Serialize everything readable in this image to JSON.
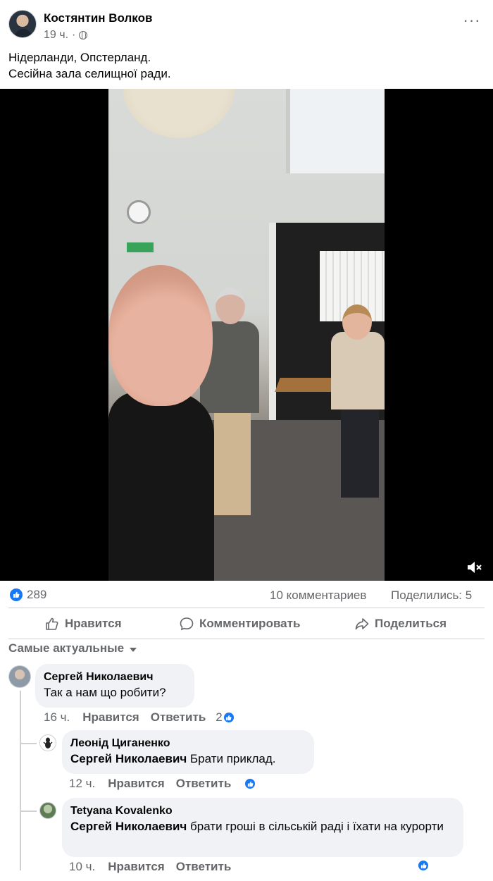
{
  "post": {
    "author": "Костянтин Волков",
    "time": "19 ч.",
    "separator": "·",
    "more": "···",
    "text_line1": "Нідерланди, Опстерланд.",
    "text_line2": "Сесійна зала селищної ради."
  },
  "icons": {
    "audience": "globe-icon",
    "more": "more-options-icon",
    "mute": "muted-speaker-icon",
    "like": "thumbs-up-icon",
    "comment": "comment-icon",
    "share": "share-icon"
  },
  "stats": {
    "likes": "289",
    "comments": "10 комментариев",
    "shares": "Поделились: 5"
  },
  "actions": {
    "like": "Нравится",
    "comment": "Комментировать",
    "share": "Поделиться"
  },
  "sort": {
    "label": "Самые актуальные"
  },
  "comments": [
    {
      "author": "Сергей Николаевич",
      "text": "Так а нам що робити?",
      "time": "16 ч.",
      "like": "Нравится",
      "reply": "Ответить",
      "reactions": "2"
    },
    {
      "author": "Леонід Циганенко",
      "mention": "Сергей Николаевич",
      "text": " Брати приклад.",
      "time": "12 ч.",
      "like": "Нравится",
      "reply": "Ответить"
    },
    {
      "author": "Tetyana Kovalenko",
      "mention": "Сергей Николаевич",
      "text": " брати гроші в сільській раді і їхати на курорти",
      "time": "10 ч.",
      "like": "Нравится",
      "reply": "Ответить"
    }
  ],
  "colors": {
    "accent": "#1877f2",
    "secondary_text": "#65676b",
    "bubble": "#f0f2f5"
  }
}
